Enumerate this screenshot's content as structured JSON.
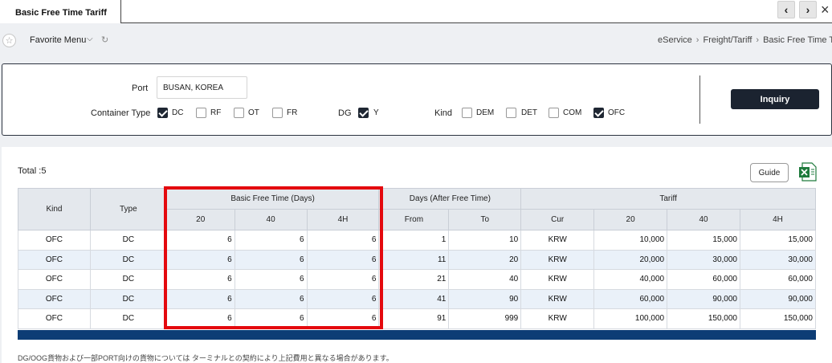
{
  "tab": {
    "title": "Basic Free Time Tariff"
  },
  "nav": {
    "prev": "‹",
    "next": "›",
    "close": "×"
  },
  "favorite": {
    "label": "Favorite Menu"
  },
  "breadcrumb": [
    "eService",
    "Freight/Tariff",
    "Basic Free Time Tariff"
  ],
  "search": {
    "port_label": "Port",
    "port_value": "BUSAN, KOREA",
    "container_type_label": "Container Type",
    "container_types": [
      {
        "label": "DC",
        "checked": true
      },
      {
        "label": "RF",
        "checked": false
      },
      {
        "label": "OT",
        "checked": false
      },
      {
        "label": "FR",
        "checked": false
      }
    ],
    "dg_label": "DG",
    "dg_option": {
      "label": "Y",
      "checked": true
    },
    "kind_label": "Kind",
    "kinds": [
      {
        "label": "DEM",
        "checked": false
      },
      {
        "label": "DET",
        "checked": false
      },
      {
        "label": "COM",
        "checked": false
      },
      {
        "label": "OFC",
        "checked": true
      }
    ],
    "inquiry_label": "Inquiry"
  },
  "results": {
    "total": "Total :5",
    "guide_label": "Guide",
    "headers": {
      "kind": "Kind",
      "type": "Type",
      "basic_free_time": "Basic Free Time (Days)",
      "days_after": "Days (After Free Time)",
      "tariff": "Tariff",
      "bft_sub": [
        "20",
        "40",
        "4H"
      ],
      "days_sub": [
        "From",
        "To"
      ],
      "tariff_sub": [
        "Cur",
        "20",
        "40",
        "4H"
      ]
    },
    "rows": [
      [
        "OFC",
        "DC",
        "6",
        "6",
        "6",
        "1",
        "10",
        "KRW",
        "10,000",
        "15,000",
        "15,000"
      ],
      [
        "OFC",
        "DC",
        "6",
        "6",
        "6",
        "11",
        "20",
        "KRW",
        "20,000",
        "30,000",
        "30,000"
      ],
      [
        "OFC",
        "DC",
        "6",
        "6",
        "6",
        "21",
        "40",
        "KRW",
        "40,000",
        "60,000",
        "60,000"
      ],
      [
        "OFC",
        "DC",
        "6",
        "6",
        "6",
        "41",
        "90",
        "KRW",
        "60,000",
        "90,000",
        "90,000"
      ],
      [
        "OFC",
        "DC",
        "6",
        "6",
        "6",
        "91",
        "999",
        "KRW",
        "100,000",
        "150,000",
        "150,000"
      ]
    ],
    "note": "DG/OOG貨物および一部PORT向けの貨物については ターミナルとの契約により上記費用と異なる場合があります。"
  },
  "colors": {
    "highlight": "#e4090e",
    "table_footer": "#0d3d75",
    "button_dark": "#1b2330"
  }
}
